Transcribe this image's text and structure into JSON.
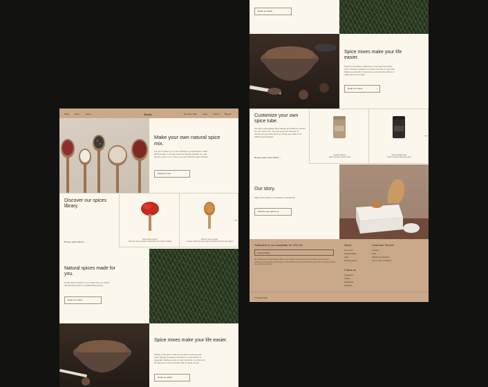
{
  "left_page": {
    "nav": {
      "items": [
        "Shop",
        "Shop",
        "About"
      ],
      "logo": "Seeds",
      "right": [
        "Recently 0 $0",
        "Login",
        "Search",
        "Bag (0)"
      ]
    },
    "hero": {
      "title": "Make your own natural spice mix.",
      "body": "Let your create try our own! Whether you decided to make them as gifts, or simply enjoy the Seeds yourself, you will find the ease it is to make your own delicious spice blends.",
      "button": "Discover more"
    },
    "discover": {
      "title": "Discover our spices library.",
      "link": "Browse spices library",
      "cards": [
        {
          "name": "Red chili pepper",
          "desc": "Stronger spicy powder created from the plant of chilies"
        },
        {
          "name": "Brown cane sugar",
          "desc": "A sweet, delicious and sugar extracted from the cane plant"
        }
      ]
    },
    "natural": {
      "title": "Natural spices made for you.",
      "body": "All the spices shown in our online shop are 100% natural and contain no artificial flavourings.",
      "button": "Read our article"
    },
    "mixes": {
      "title": "Spice mixes make your life easier.",
      "body": "Variety is the spice of life for the first consciousness cook. Having a selection of spices in your kitchen is essential. Getting a taste of your favourite on a bite and the flavours of your favourite dish is made simple.",
      "button": "Read our article"
    }
  },
  "right_page": {
    "top": {
      "button": "Read our article"
    },
    "mixes": {
      "title": "Spice mixes make your life easier.",
      "body": "Seeds is the place of little life for the mind conscious cook. Having a selection of spices at home is essential. Making a selection of spices to your favourite dishes to make them more taste.",
      "button": "Read our article"
    },
    "customize": {
      "title": "Customize your own spice tube.",
      "body": "We offer personalised label design and different colours for your spice mix. You can enjoy the changes to choose as you want. All of our tubes are made from 100% recycled glass.",
      "link": "Browse spice colors library",
      "tubes": [
        {
          "name": "Seeds Nature",
          "desc": "100% recycled natural color"
        },
        {
          "name": "Seeds Dark gray",
          "desc": "100% recycled dark gray color"
        }
      ]
    },
    "story": {
      "title": "Our story.",
      "body": "Made with passion in our Berlin manufacture.",
      "button": "Visit the story about us"
    },
    "footer": {
      "newsletter_title": "Subscribe to our newsletter for 10% off.",
      "email_placeholder": "Email Address",
      "newsletter_body": "By entering your email address above, you consent to receiving communications about Seeds products, special offers and bloopers. Your details will not be transferred to any other company. Please see our Privacy Policy.",
      "about_title": "About",
      "about_links": [
        "Our story",
        "Sustainability",
        "Jobs",
        "Privacy policy"
      ],
      "follow_title": "Follow us",
      "follow_links": [
        "Instagram",
        "Twitter",
        "Facebook",
        "LinkedIn"
      ],
      "service_title": "Customer Service",
      "service_links": [
        "Contact",
        "FAQ",
        "Shipping & Returns",
        "Terms and conditions"
      ],
      "copyright": "© Seeds 2022"
    }
  },
  "colors": {
    "background": "#121211",
    "cream": "#fcf7ec",
    "tan": "#caa98a",
    "rosemary": "#25311f"
  }
}
